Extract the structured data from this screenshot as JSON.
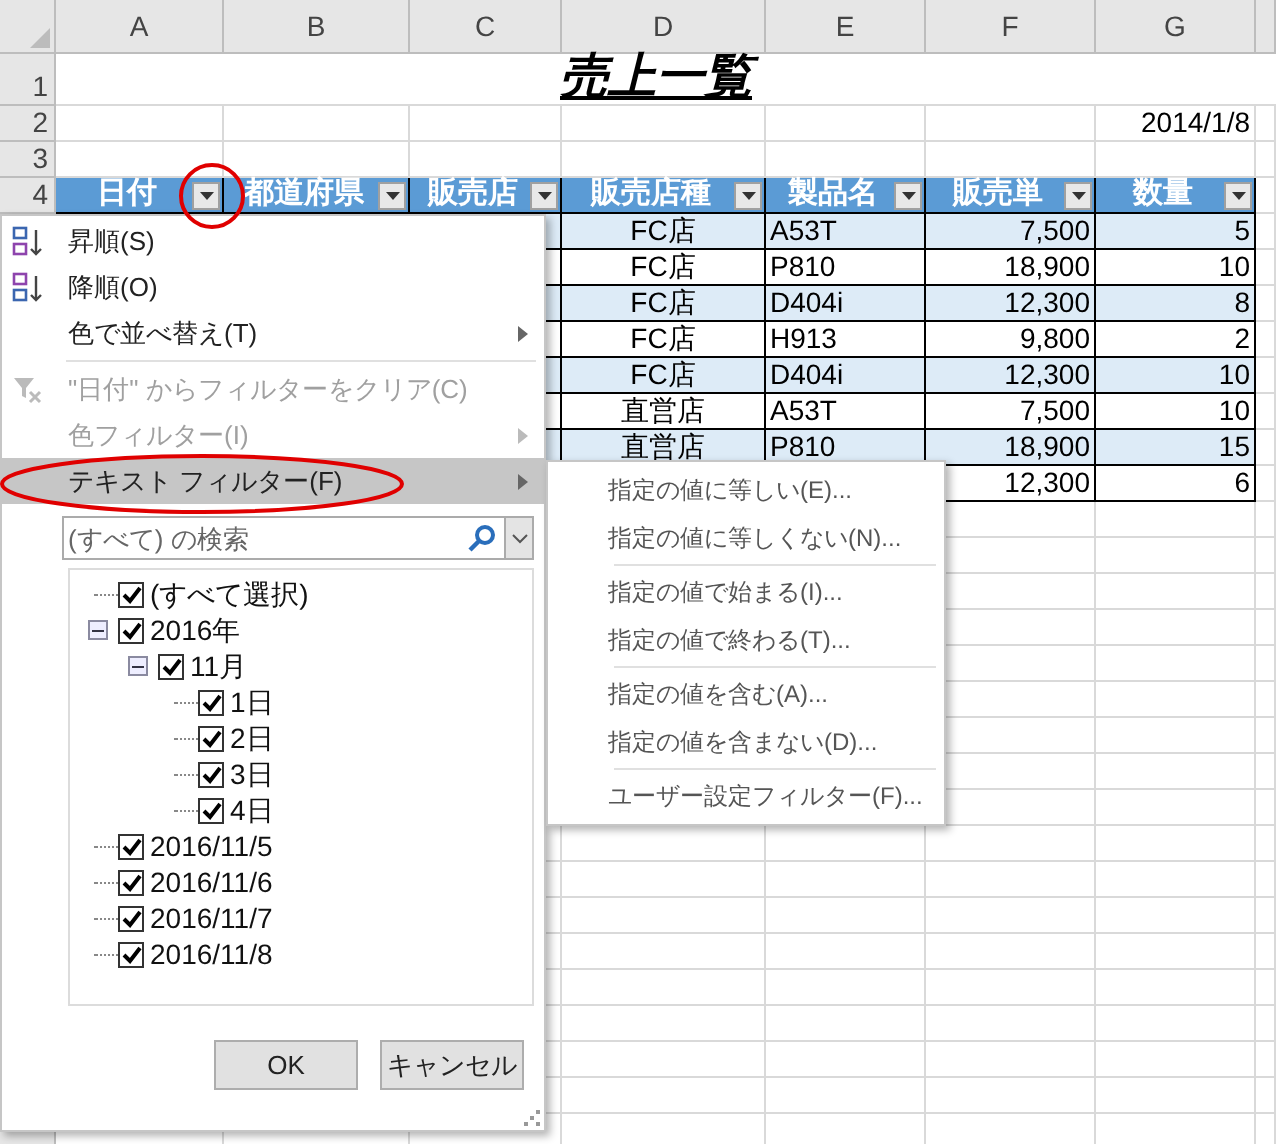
{
  "sheet": {
    "columns": [
      "A",
      "B",
      "C",
      "D",
      "E",
      "F",
      "G"
    ],
    "row_numbers": [
      "1",
      "2",
      "3",
      "4"
    ],
    "title": "売上一覧",
    "date": "2014/1/8",
    "headers": [
      {
        "label": "日付",
        "filter_button": true
      },
      {
        "label": "都道府県",
        "filter_button": true
      },
      {
        "label": "販売店",
        "filter_button": true
      },
      {
        "label": "販売店種",
        "filter_button": true
      },
      {
        "label": "製品名",
        "filter_button": true
      },
      {
        "label": "販売単",
        "filter_button": true
      },
      {
        "label": "数量",
        "filter_button": true
      }
    ],
    "data_rows": [
      {
        "col_d": "FC店",
        "col_e": "A53T",
        "col_f": "7,500",
        "col_g": "5"
      },
      {
        "col_d": "FC店",
        "col_e": "P810",
        "col_f": "18,900",
        "col_g": "10"
      },
      {
        "col_d": "FC店",
        "col_e": "D404i",
        "col_f": "12,300",
        "col_g": "8"
      },
      {
        "col_d": "FC店",
        "col_e": "H913",
        "col_f": "9,800",
        "col_g": "2"
      },
      {
        "col_d": "FC店",
        "col_e": "D404i",
        "col_f": "12,300",
        "col_g": "10"
      },
      {
        "col_d": "直営店",
        "col_e": "A53T",
        "col_f": "7,500",
        "col_g": "10"
      },
      {
        "col_d": "直営店",
        "col_e": "P810",
        "col_f": "18,900",
        "col_g": "15"
      },
      {
        "col_f": "12,300",
        "col_g": "6"
      }
    ]
  },
  "filter_menu": {
    "items": [
      {
        "kind": "sort_asc",
        "label": "昇順(S)",
        "disabled": false,
        "submenu": false,
        "selected": false
      },
      {
        "kind": "sort_desc",
        "label": "降順(O)",
        "disabled": false,
        "submenu": false,
        "selected": false
      },
      {
        "kind": "plain",
        "label": "色で並べ替え(T)",
        "disabled": false,
        "submenu": true,
        "selected": false
      },
      {
        "kind": "separator"
      },
      {
        "kind": "clear",
        "label": "\"日付\" からフィルターをクリア(C)",
        "disabled": true,
        "submenu": false,
        "selected": false
      },
      {
        "kind": "plain",
        "label": "色フィルター(I)",
        "disabled": true,
        "submenu": true,
        "selected": false
      },
      {
        "kind": "plain",
        "label": "テキスト フィルター(F)",
        "disabled": false,
        "submenu": true,
        "selected": true
      }
    ],
    "search": {
      "placeholder": "(すべて) の検索"
    },
    "tree": [
      {
        "label": "(すべて選択)",
        "checked": true
      },
      {
        "label": "2016年",
        "checked": true,
        "expanded": true,
        "children": [
          {
            "label": "11月",
            "checked": true,
            "expanded": true,
            "children": [
              {
                "label": "1日",
                "checked": true
              },
              {
                "label": "2日",
                "checked": true
              },
              {
                "label": "3日",
                "checked": true
              },
              {
                "label": "4日",
                "checked": true
              }
            ]
          }
        ]
      },
      {
        "label": "2016/11/5",
        "checked": true
      },
      {
        "label": "2016/11/6",
        "checked": true
      },
      {
        "label": "2016/11/7",
        "checked": true
      },
      {
        "label": "2016/11/8",
        "checked": true
      }
    ],
    "buttons": [
      "OK",
      "キャンセル"
    ]
  },
  "text_filter_submenu": {
    "groups": [
      [
        "指定の値に等しい(E)...",
        "指定の値に等しくない(N)..."
      ],
      [
        "指定の値で始まる(I)...",
        "指定の値で終わる(T)..."
      ],
      [
        "指定の値を含む(A)...",
        "指定の値を含まない(D)..."
      ],
      [
        "ユーザー設定フィルター(F)..."
      ]
    ]
  }
}
